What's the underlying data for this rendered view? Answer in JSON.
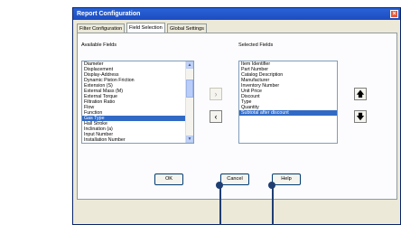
{
  "window": {
    "title": "Report Configuration",
    "close_glyph": "×"
  },
  "tabs": [
    {
      "label": "Filter Configuration"
    },
    {
      "label": "Field Selection",
      "active": true
    },
    {
      "label": "Global Settings"
    }
  ],
  "available": {
    "label": "Available Fields",
    "items": [
      "Diameter",
      "Displacement",
      "Display-Address",
      "Dynamic Piston Friction",
      "Extension (S)",
      "External Mass (M)",
      "External Torque",
      "Filtration Ratio",
      "Flow",
      "Function",
      "Gas Type",
      "Hall Stroke",
      "Inclination (a)",
      "Input Number",
      "Installation Number"
    ],
    "selected_index": 10
  },
  "selected": {
    "label": "Selected Fields",
    "items": [
      "Item Identifier",
      "Part Number",
      "Catalog Description",
      "Manufacturer",
      "Inventory Number",
      "Unit Price",
      "Discount",
      "Type",
      "Quantity",
      "Subtotal after discount"
    ],
    "selected_index": 9
  },
  "transfer": {
    "add_glyph": "›",
    "remove_glyph": "‹"
  },
  "reorder": {
    "up_glyph": "🡅",
    "down_glyph": "🡇"
  },
  "buttons": {
    "ok": "OK",
    "cancel": "Cancel",
    "help": "Help"
  },
  "scroll": {
    "up_glyph": "▲",
    "down_glyph": "▼"
  }
}
